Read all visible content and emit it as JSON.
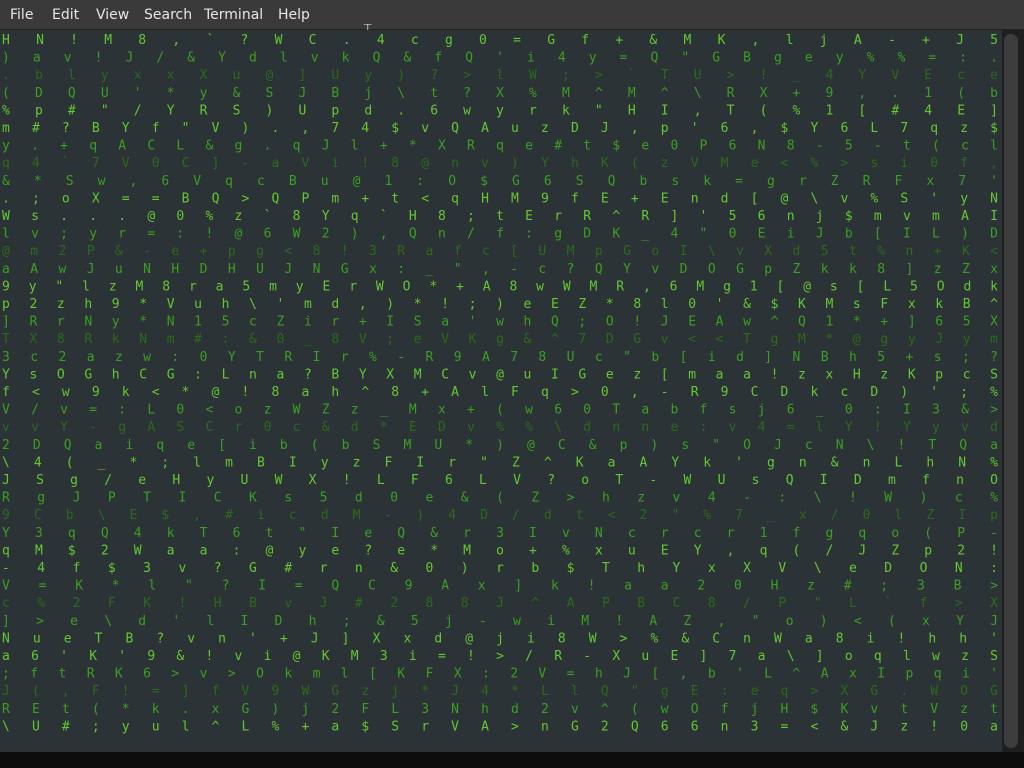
{
  "menubar": {
    "items": [
      "File",
      "Edit",
      "View",
      "Search",
      "Terminal",
      "Help"
    ]
  },
  "icons": {
    "cursor": "text-cursor-icon"
  },
  "colors": {
    "menubar_bg": "#3a3a3a",
    "terminal_bg": "#2b3336",
    "glyph_bright": "#64c832",
    "glyph_mid": "#3c9e22",
    "glyph_dim": "#2a6a1a",
    "glyph_white": "#e8ffe0"
  },
  "terminal": {
    "rows": [
      "H  N  !  M  8 ,  `  ? W C .  4 c g  0 = G  f + & M K ,   l   j  A -  + J  5",
      ")  a  v  !  J /  &  Y d l v  k Q  & f  Q  ' i 4 y = Q \" G B g e  y % %  = :  .",
      ".  b  l  y  x x  X  u @ ] U  y  ) ?  > l W ; >  ` T U > ! _  4 Y V  E c  e",
      "(  D  Q  U '  *  y & S J  B j  \\ t ?  X % M ^  M ^ \\ R X +  9 , .  1 (  b",
      "% p #  \"  / Y  R  S ) U  p d  . 6  w y r k \"  H I ,  T ( %  1 [ #  4 E  ]",
      "m # ?  B  Y f  \"  V ) . ,  7 4  $ v Q  A u z  D J  , p '  6 , $  Y 6 L  7 q  z $",
      "y . +  q  A C L  &  g  . q J  l + * X R  q e # t $  e 0 P 6 N  8 - 5 -  t (  c l",
      "q 4 `  7  V 0 C  ]  - a V i  ! 8 @ n v  ) Y h K (  z V M e <  %  > s i  0 f ,",
      "& *  S  w , 6  V  q c B u @  1 : O $ G  6 S Q b s  k = g r  Z  R  F  x 7 '",
      ".  ;  o  X = =  B  Q > Q P m +  t < q H M  9 f E + E  n d [ @  \\  v % S  ' y N",
      "W  s  .  . . @  0  % z ` 8 Y q  ` H 8 ; t  E r  R ^  R ] ' 5  6 n j $ m  v m A I",
      "l  v  ;  y r =  :  ! @ 6  W 2 ) , Q  n / f  :  g D K  _ 4 \" 0  E  i J b  [  I L ) D",
      "@  m 2  P  & - e  +  p g  < 8 ! 3 R  a f c  [  U M p  G o I \\  v X d 5 t  %  n + K <",
      "a  A  w  J u N H  D  H  U J N G x : _  \" , -  c  ? Q  Y v D O  G p Z k k  8  ] z Z x",
      "9  y \"  l  z M 8 r  a  5 m  y E r W O * +  A 8 w  W M R ,  6 M g  1  [  @ s [  L  5 O d k",
      "p  2 z  h  9 * V u  h  \\ '  m d , ) * ! ;  ) e E  Z  * 8 l  0 '  &  $ K  M s F  x k B ^",
      "]  R r  N  y * N  1  5 c Z  i r + I S a '  w h Q  ; O ! J E  A w ^  Q  1 * + ]  6 5 X",
      "T  X 8  R  k  N  m # : & 0 _ 8 V ; e  V K g & ^ 7  D G v  < <  T  g M  * @ g y  J y m",
      "3  c 2  a  z  w  : 0 Y T R I r % - R  9 A 7 8 U c  \" b [  i d ]  N B  h 5 +  s ;  ?",
      "Y  s O  G  h  C  G : L n a ? B Y X M C  v @ u I G e  z [ m  a a !  z  x H z K  p c  S",
      "f  < w  9  k  < * @ ! 8 a h ^ 8 + A  l F q > 0 ,  - R  9 C D  k  c D ) '  ;  %",
      "V  /  v = :  L 0 < o z W Z z _ M x  + ( w 6 0  T a b f s  j 6 _  0  : I  3 &  >",
      "v  v Y - g A  S C r 0 c & d * E D v  % % \\ d  n  n e : v  4 = l  Y  ! Y  y v d",
      "2 D  Q  a  i q  e [ i b ( b S  M U *  ) @ C & p  ) s \"  O J  c  N \\  ! T Q a",
      "\\ 4  (  _  * ;  l m B I y z F  I r \" Z ^  K a  A Y  k '  g  n & n L h N  %",
      "J S  g  /  e H  y U W X ! L F  6 L V ?  o T  -  W U  s  Q I D m f n  O",
      "R  g  J  P T  I C K s 5 d  0 e & (  Z  > h z v  4  -  : \\ ! W ) c  %",
      "9 C  b  \\  E $  ,  # i c d M -  ) 4 D /  d t  < 2 \"  %  7  _ x / 0 l Z I  p",
      "Y  3  q  Q 4  k  T 6 t \" I e  Q & r 3  I v  N c r  c r  1  f g q  o ( P  -",
      "q  M  $  2 W  a  a : @ y e ?  e * M o  +  %  x u E  Y ,  q  ( / J  Z p 2  !",
      "-  4  f  $ 3  v ? G  # r n &  0 ) r b  $ T  h Y x  X V  \\  e D O  N :",
      "V  =  K  * l  \" ? I  = Q C 9  A x ] k  !  a  a 2 0  H z  #  ; 3 B  >",
      "c  %  2  F K  ! H B  v J # 2  8 8 J ^  A P  B C 8 /  P \" L  `  f >  X",
      "]  >  e  \\ d  ' l I D  h ;  & 5 j -  w i  M ! A Z  , \" o  )  < ( x Y  J",
      "N  u  e  T B  ? v n '  + J ]  X x d @ j i  8 W > %  & C  n W a  8 i ! h  h '",
      "a  6 ' K  '  9 & ! v  i @ K  M 3 i = ! >  /  R - X u E  ] 7 a \\ ]  o q l w  z S",
      ";  f t R K  6 > v >  O k m  l [ K F X :  2 V = h  J [ ,  b ' L ^ A  x I p q  i '",
      "J  ( , F  ! = ] f  V 9 W G  z j * J 4  * L l Q \" g E : e q  > X G . W  O G",
      "R E  t ( *  k . x G  ) j 2 F  L 3 N h d  2 v  ^  ( w O f j H  $ K v t V  z t",
      "\\ U #  ; y u  l ^ L %  + a $ S r  V A > n G  2 Q  6  6 n 3 =  <  & J z ! 0  a"
    ]
  }
}
